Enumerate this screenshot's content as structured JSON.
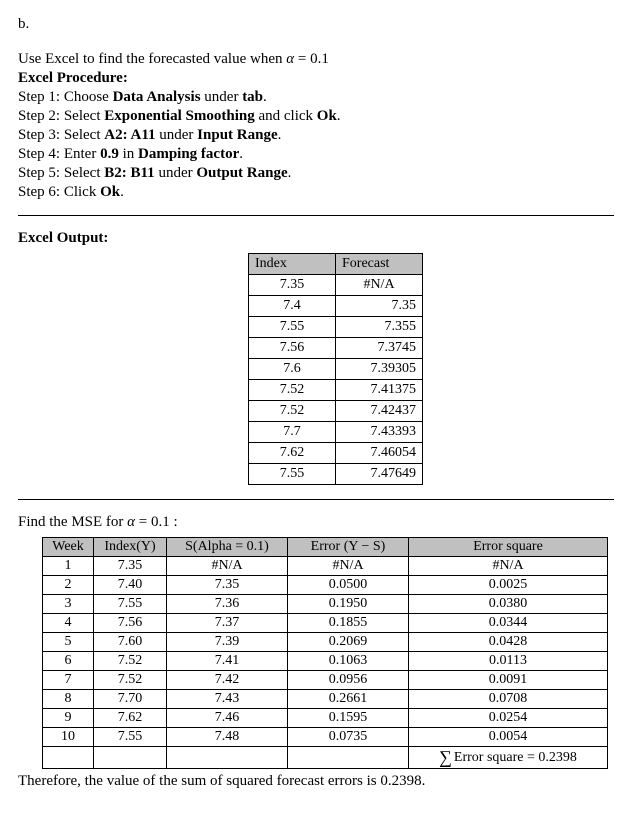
{
  "label_b": "b.",
  "intro_prefix": "Use Excel to find the forecasted value when ",
  "alpha_sym": "α",
  "eq01": " = 0.1",
  "proc_heading": "Excel Procedure:",
  "steps": {
    "s1a": "Step 1: Choose ",
    "s1b": "Data Analysis",
    "s1c": " under ",
    "s1d": "tab",
    "s1e": ".",
    "s2a": "Step 2: Select ",
    "s2b": "Exponential Smoothing",
    "s2c": " and click ",
    "s2d": "Ok",
    "s2e": ".",
    "s3a": "Step 3: Select ",
    "s3b": "A2: A11",
    "s3c": " under ",
    "s3d": "Input Range",
    "s3e": ".",
    "s4a": "Step 4: Enter ",
    "s4b": "0.9",
    "s4c": " in ",
    "s4d": "Damping factor",
    "s4e": ".",
    "s5a": "Step 5: Select ",
    "s5b": "B2: B11",
    "s5c": " under ",
    "s5d": "Output Range",
    "s5e": ".",
    "s6a": "Step 6: Click ",
    "s6b": "Ok",
    "s6c": "."
  },
  "out_heading": "Excel Output:",
  "out_headers": {
    "index": "Index",
    "forecast": "Forecast"
  },
  "out_rows": [
    {
      "i": "7.35",
      "f": "#N/A",
      "na": true
    },
    {
      "i": "7.4",
      "f": "7.35"
    },
    {
      "i": "7.55",
      "f": "7.355"
    },
    {
      "i": "7.56",
      "f": "7.3745"
    },
    {
      "i": "7.6",
      "f": "7.39305"
    },
    {
      "i": "7.52",
      "f": "7.41375"
    },
    {
      "i": "7.52",
      "f": "7.42437"
    },
    {
      "i": "7.7",
      "f": "7.43393"
    },
    {
      "i": "7.62",
      "f": "7.46054"
    },
    {
      "i": "7.55",
      "f": "7.47649"
    }
  ],
  "mse_prefix": "Find the MSE for ",
  "mse_eq": " = 0.1 :",
  "mse_headers": {
    "week": "Week",
    "y": "Index(Y)",
    "s": "S(Alpha = 0.1)",
    "err": "Error (Y − S)",
    "sq": "Error square"
  },
  "mse_rows": [
    {
      "w": "1",
      "y": "7.35",
      "s": "#N/A",
      "e": "#N/A",
      "q": "#N/A"
    },
    {
      "w": "2",
      "y": "7.40",
      "s": "7.35",
      "e": "0.0500",
      "q": "0.0025"
    },
    {
      "w": "3",
      "y": "7.55",
      "s": "7.36",
      "e": "0.1950",
      "q": "0.0380"
    },
    {
      "w": "4",
      "y": "7.56",
      "s": "7.37",
      "e": "0.1855",
      "q": "0.0344"
    },
    {
      "w": "5",
      "y": "7.60",
      "s": "7.39",
      "e": "0.2069",
      "q": "0.0428"
    },
    {
      "w": "6",
      "y": "7.52",
      "s": "7.41",
      "e": "0.1063",
      "q": "0.0113"
    },
    {
      "w": "7",
      "y": "7.52",
      "s": "7.42",
      "e": "0.0956",
      "q": "0.0091"
    },
    {
      "w": "8",
      "y": "7.70",
      "s": "7.43",
      "e": "0.2661",
      "q": "0.0708"
    },
    {
      "w": "9",
      "y": "7.62",
      "s": "7.46",
      "e": "0.1595",
      "q": "0.0254"
    },
    {
      "w": "10",
      "y": "7.55",
      "s": "7.48",
      "e": "0.0735",
      "q": "0.0054"
    }
  ],
  "sum_label_pre": "Error square = ",
  "sum_value": "0.2398",
  "sigma": "∑",
  "conclusion": "Therefore, the value of the sum of squared forecast errors is 0.2398."
}
